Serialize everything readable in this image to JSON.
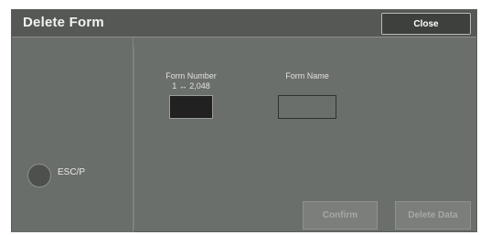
{
  "window": {
    "title": "Delete Form",
    "close_label": "Close"
  },
  "left_panel": {
    "option_label": "ESC/P",
    "option_selected": false
  },
  "fields": {
    "form_number_label": "Form Number",
    "form_number_range": "1 ↔ 2,048",
    "form_number_value": "",
    "form_name_label": "Form Name",
    "form_name_value": ""
  },
  "actions": {
    "confirm_label": "Confirm",
    "delete_data_label": "Delete Data"
  }
}
